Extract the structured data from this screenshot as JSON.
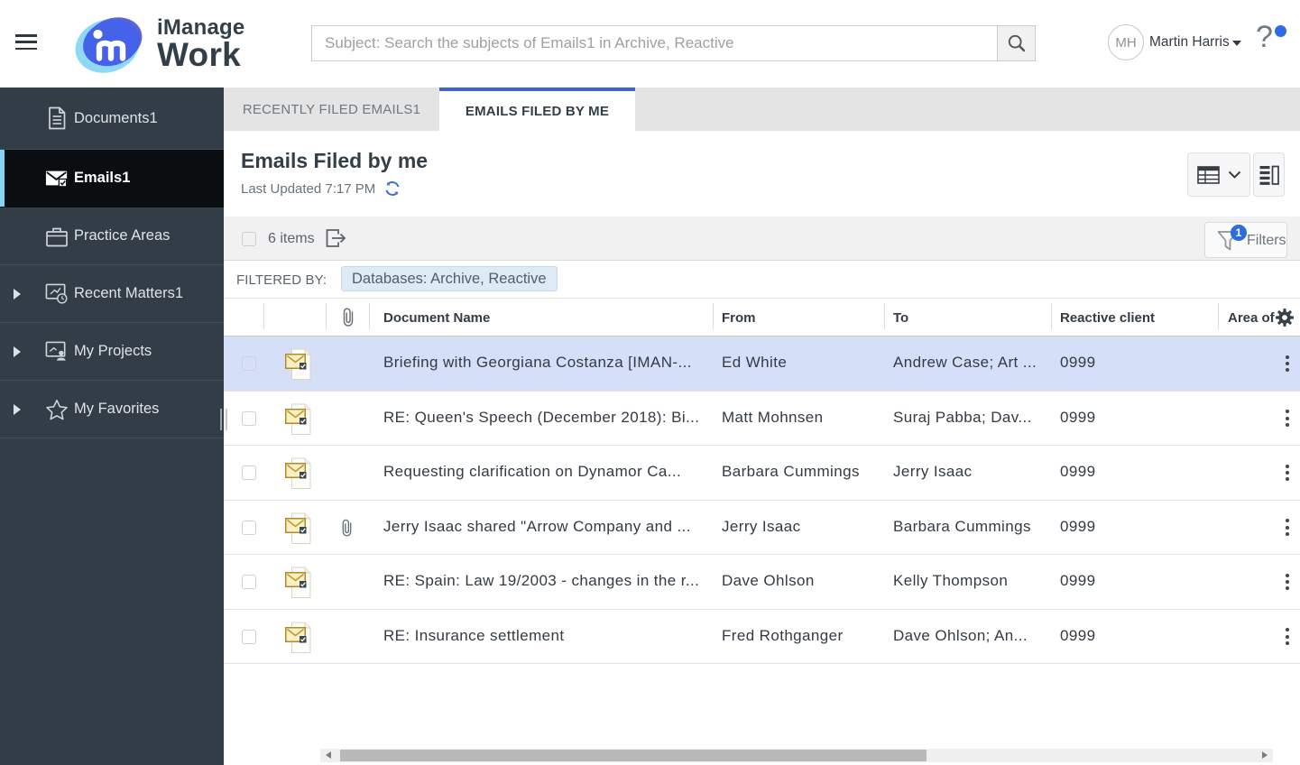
{
  "colors": {
    "accent_blue": "#3A66D1",
    "badge_blue": "#2E6BE0",
    "notification_blue": "#2E6BE6",
    "sidebar_bg": "#333D47",
    "sidebar_selected_bg": "#0B0E11",
    "sidebar_selected_bar": "#85D4F2",
    "selected_row_bg": "#D5DFF7",
    "chip_bg": "#DEEBF7",
    "tab_strip_bg": "#E4E4E4",
    "logo_light_blue": "#8ED8F8",
    "logo_royal_blue": "#4460E8"
  },
  "header": {
    "brand": "iManage",
    "product": "Work",
    "search_placeholder": "Subject: Search the subjects of Emails1 in Archive, Reactive",
    "user_initials": "MH",
    "user_name": "Martin Harris"
  },
  "sidebar": {
    "items": [
      {
        "label": "Documents1",
        "icon": "document-icon",
        "active": false,
        "expandable": false
      },
      {
        "label": "Emails1",
        "icon": "email-check-icon",
        "active": true,
        "expandable": false
      },
      {
        "label": "Practice Areas",
        "icon": "briefcase-icon",
        "active": false,
        "expandable": false
      },
      {
        "label": "Recent Matters1",
        "icon": "matter-clock-icon",
        "active": false,
        "expandable": true
      },
      {
        "label": "My Projects",
        "icon": "project-person-icon",
        "active": false,
        "expandable": true
      },
      {
        "label": "My Favorites",
        "icon": "star-icon",
        "active": false,
        "expandable": true
      }
    ]
  },
  "tabs": [
    {
      "label": "RECENTLY FILED EMAILS1",
      "active": false
    },
    {
      "label": "EMAILS FILED BY ME",
      "active": true
    }
  ],
  "page": {
    "title": "Emails Filed by me",
    "last_updated": "Last Updated 7:17 PM"
  },
  "toolbar": {
    "items_count": "6 items",
    "filters_label": "Filters",
    "filters_badge": "1"
  },
  "filter_bar": {
    "label": "FILTERED BY:",
    "chip": "Databases: Archive, Reactive"
  },
  "table": {
    "columns": {
      "name": "Document Name",
      "from": "From",
      "to": "To",
      "client": "Reactive client",
      "area": "Area of"
    },
    "rows": [
      {
        "name": "Briefing with Georgiana Costanza [IMAN-...",
        "from": "Ed White",
        "to": "Andrew Case; Art ...",
        "client": "0999",
        "attachment": false,
        "selected": true
      },
      {
        "name": "RE: Queen's Speech (December 2018): Bi...",
        "from": "Matt Mohnsen",
        "to": "Suraj Pabba; Dav...",
        "client": "0999",
        "attachment": false,
        "selected": false
      },
      {
        "name": "Requesting clarification on Dynamor Ca...",
        "from": "Barbara Cummings",
        "to": "Jerry Isaac",
        "client": "0999",
        "attachment": false,
        "selected": false
      },
      {
        "name": "Jerry Isaac shared \"Arrow Company and ...",
        "from": "Jerry Isaac",
        "to": "Barbara Cummings",
        "client": "0999",
        "attachment": true,
        "selected": false
      },
      {
        "name": "RE: Spain: Law 19/2003 - changes in the r...",
        "from": "Dave Ohlson",
        "to": "Kelly Thompson",
        "client": "0999",
        "attachment": false,
        "selected": false
      },
      {
        "name": "RE: Insurance settlement",
        "from": "Fred Rothganger",
        "to": "Dave Ohlson; An...",
        "client": "0999",
        "attachment": false,
        "selected": false
      }
    ]
  }
}
